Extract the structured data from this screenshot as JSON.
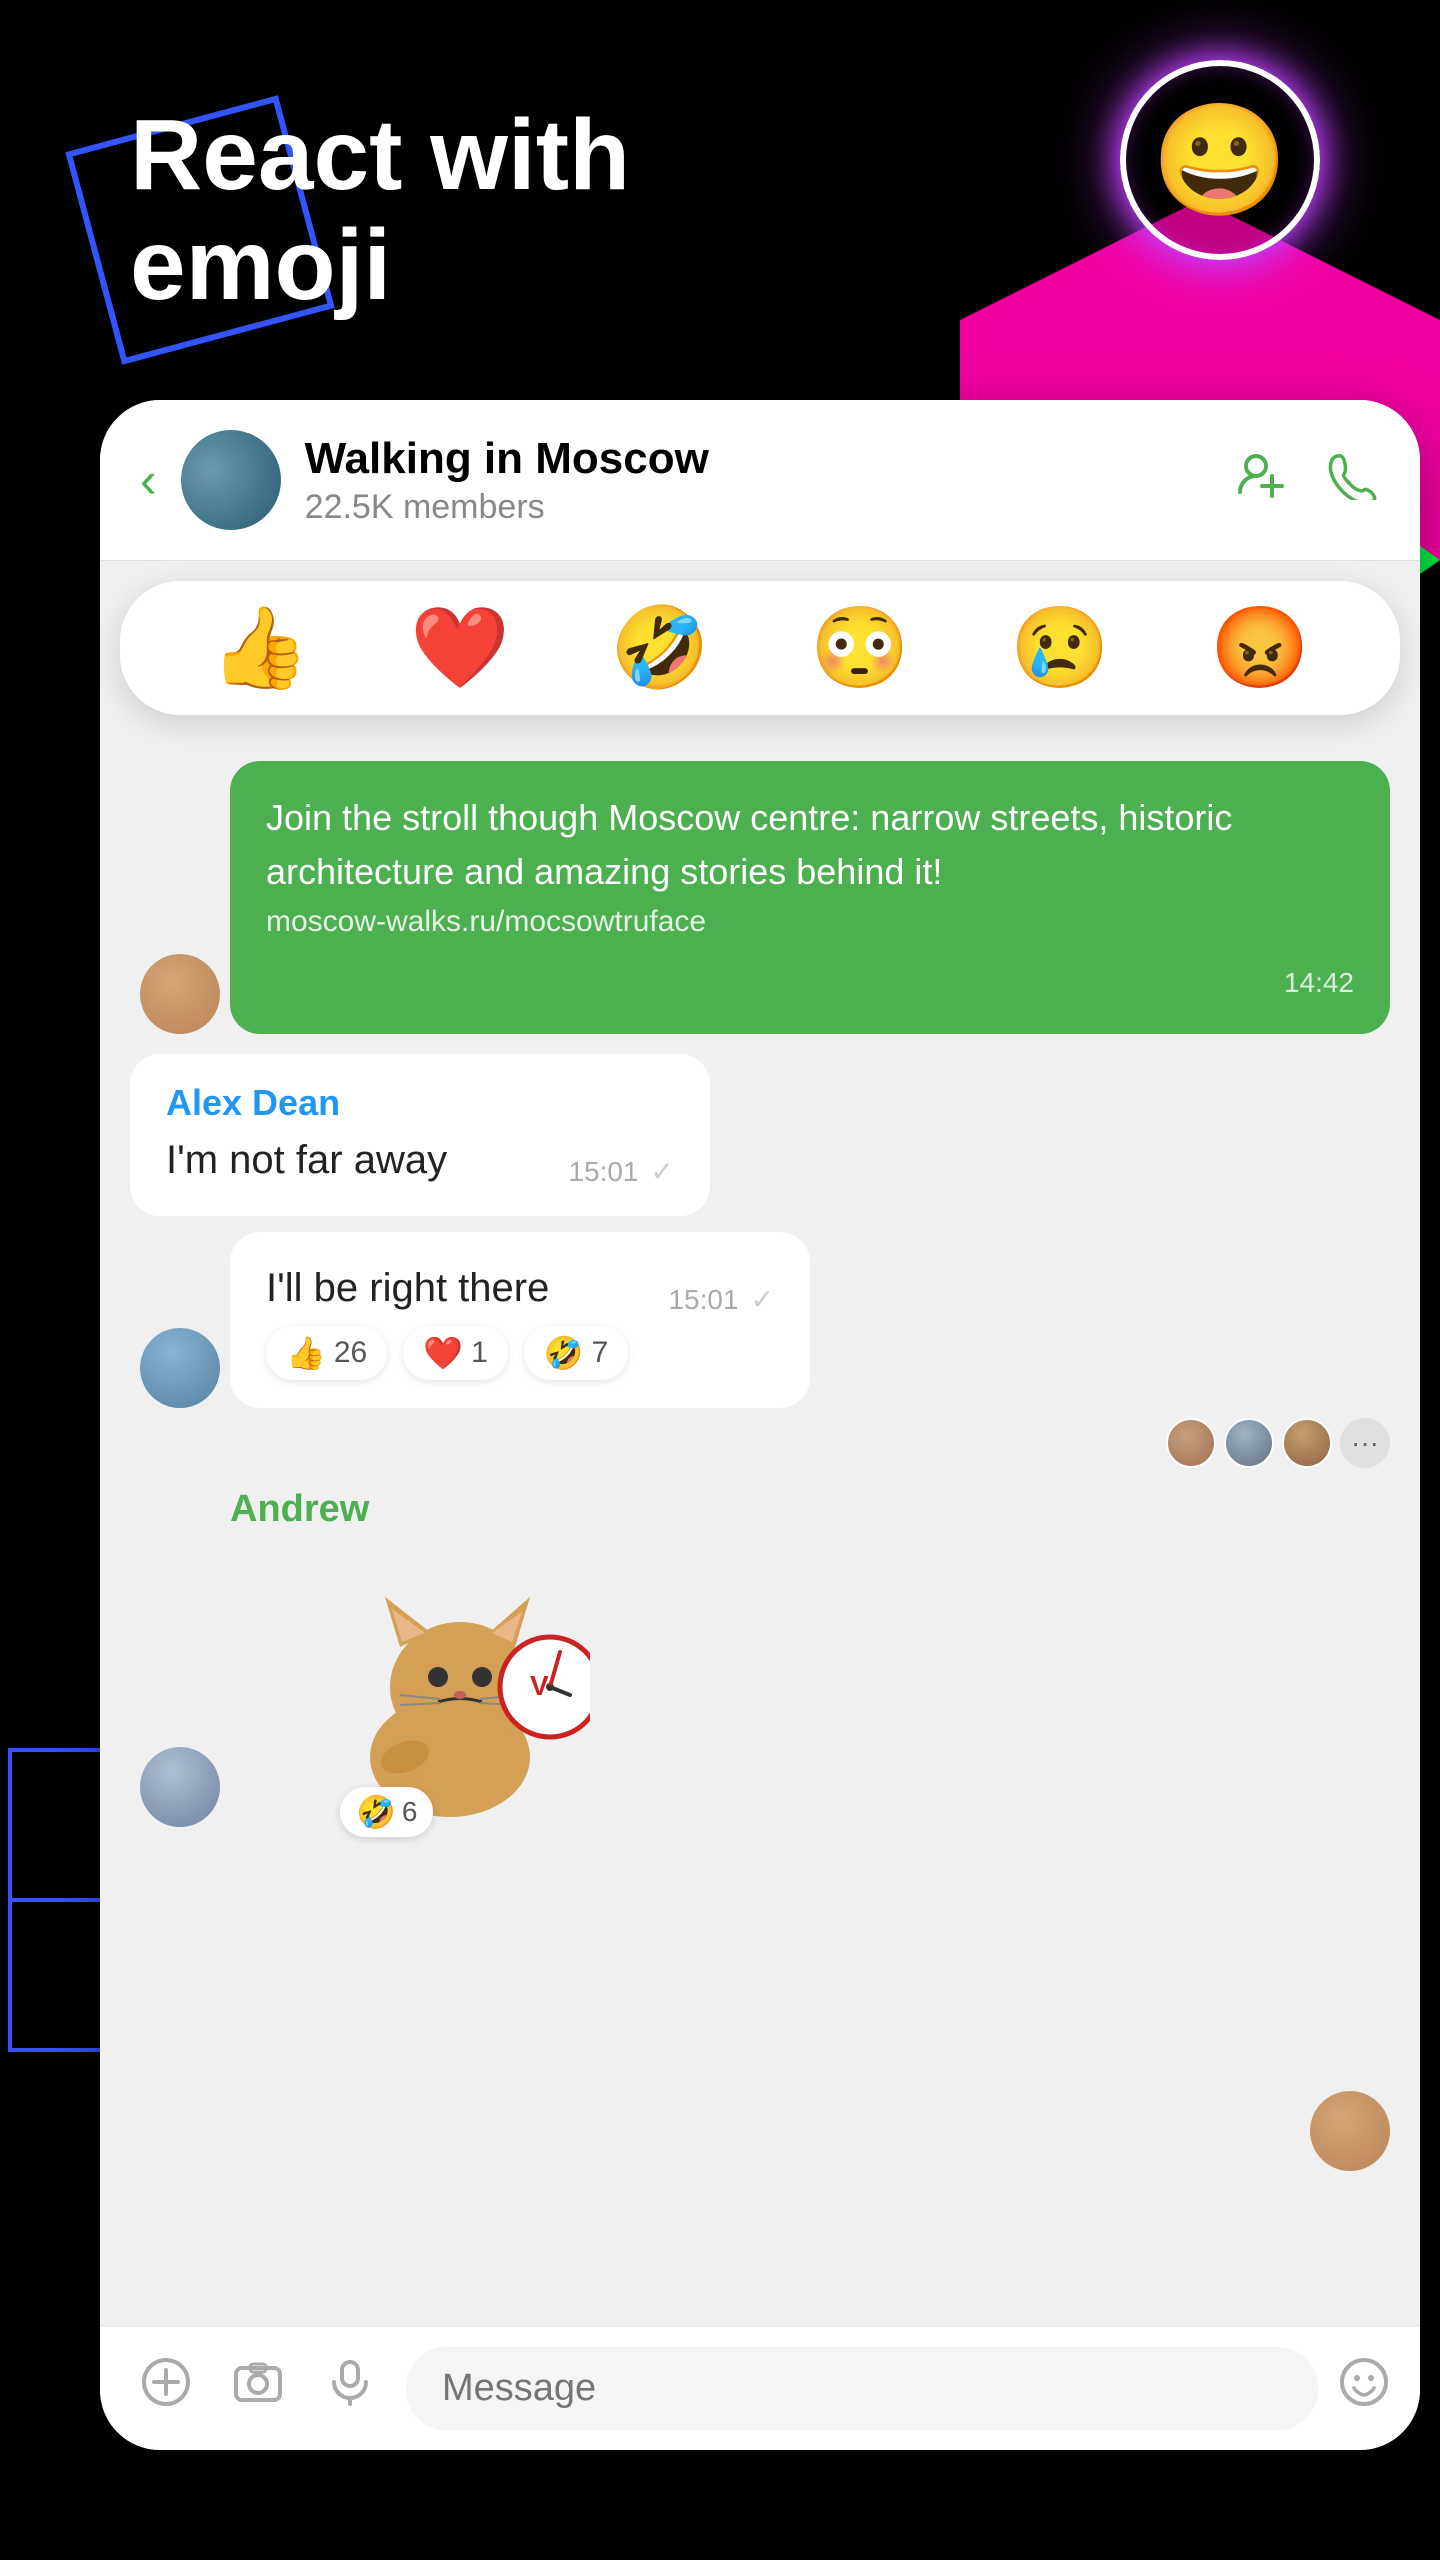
{
  "hero": {
    "title_line1": "React with",
    "title_line2": "emoji"
  },
  "decorative": {
    "neon_emoji": "😀"
  },
  "chat": {
    "back_label": "‹",
    "name": "Walking in Moscow",
    "members": "22.5K members",
    "add_member_icon": "+👤",
    "call_icon": "📞"
  },
  "emoji_bar": {
    "emojis": [
      "👍",
      "❤️",
      "🤣",
      "😳",
      "😢",
      "😡"
    ]
  },
  "messages": [
    {
      "type": "green_bubble",
      "text": "Join the stroll though Moscow centre: narrow streets, historic architecture and amazing stories behind it!",
      "link": "moscow-walks.ru/mocsowtruface",
      "time": "14:42"
    },
    {
      "type": "white_bubble",
      "sender": "Alex Dean",
      "text": "I'm not far away",
      "time": "15:01",
      "has_tick": true
    },
    {
      "type": "white_bubble_reactions",
      "text": "I'll be right there",
      "time": "15:01",
      "has_tick": true,
      "reactions": [
        {
          "emoji": "👍",
          "count": "26"
        },
        {
          "emoji": "❤️",
          "count": "1"
        },
        {
          "emoji": "🤣",
          "count": "7"
        }
      ]
    }
  ],
  "andrew_section": {
    "name": "Andrew",
    "sticker_reaction": {
      "emoji": "🤣",
      "count": "6"
    }
  },
  "input_bar": {
    "placeholder": "Message",
    "add_icon": "+",
    "photo_icon": "🖼",
    "mic_icon": "🎤",
    "emoji_icon": "🙂"
  }
}
